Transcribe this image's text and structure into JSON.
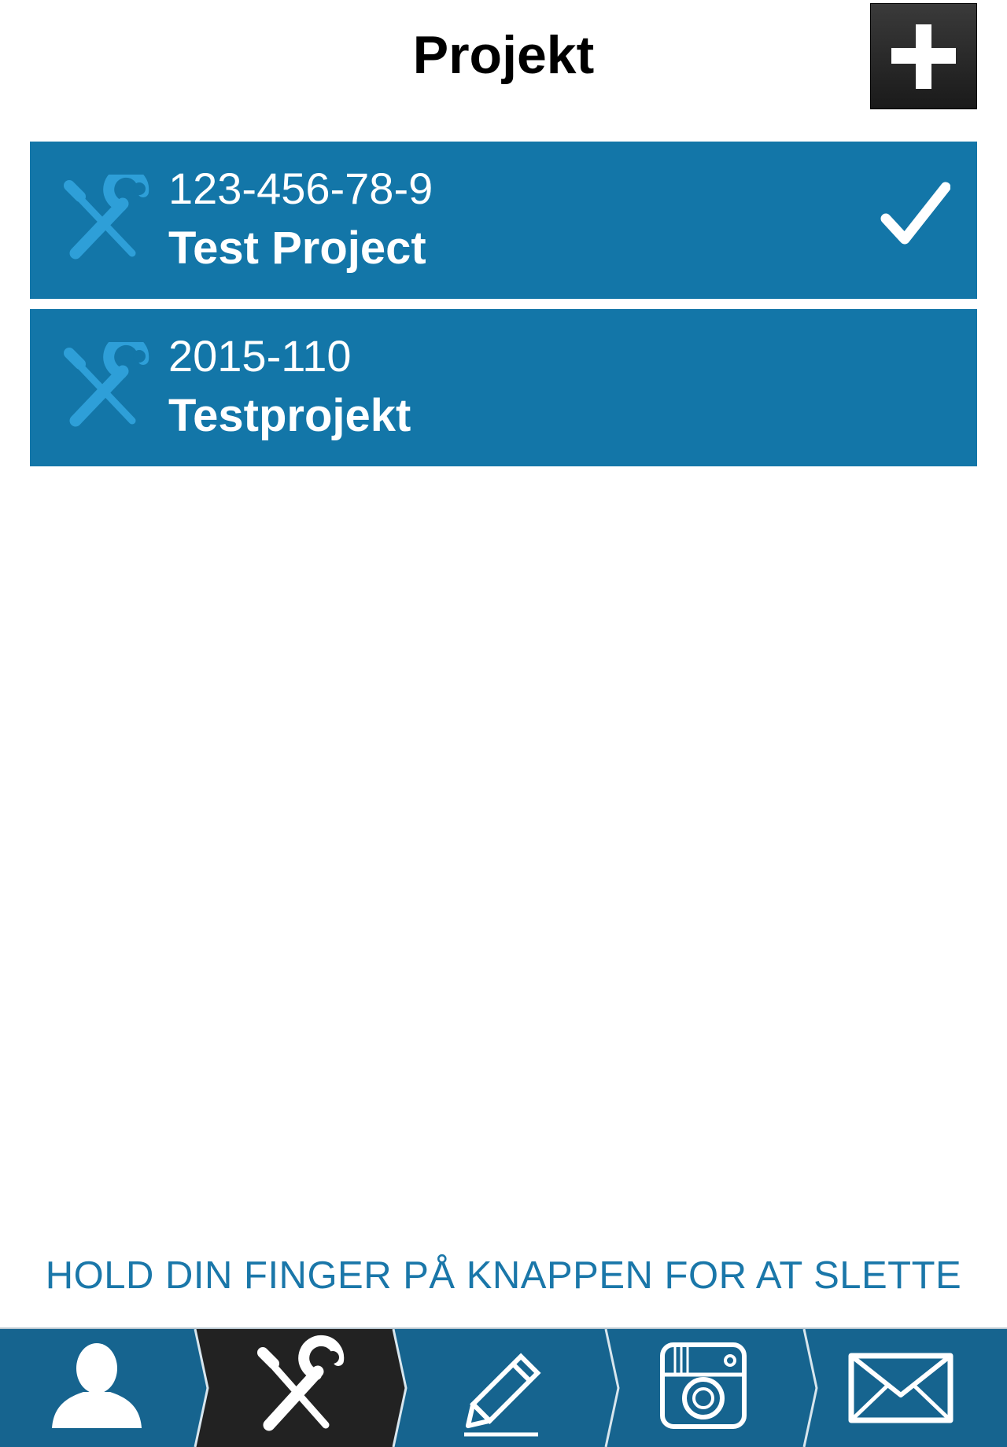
{
  "header": {
    "title": "Projekt",
    "add_button_icon": "plus-icon"
  },
  "projects": [
    {
      "number": "123-456-78-9",
      "name": "Test Project",
      "icon": "tools-icon",
      "selected": true
    },
    {
      "number": "2015-110",
      "name": "Testprojekt",
      "icon": "tools-icon",
      "selected": false
    }
  ],
  "hint": "HOLD DIN FINGER PÅ KNAPPEN FOR AT SLETTE",
  "tabbar": {
    "tabs": [
      {
        "icon": "person-icon",
        "active": false
      },
      {
        "icon": "tools-icon",
        "active": true
      },
      {
        "icon": "pencil-icon",
        "active": false
      },
      {
        "icon": "camera-icon",
        "active": false
      },
      {
        "icon": "envelope-icon",
        "active": false
      }
    ]
  },
  "colors": {
    "item_background": "#1376a8",
    "tabbar_background": "#16648f",
    "active_tab": "#222222",
    "hint_text": "#1a77a9",
    "icon_blue": "#2e9fd8"
  }
}
